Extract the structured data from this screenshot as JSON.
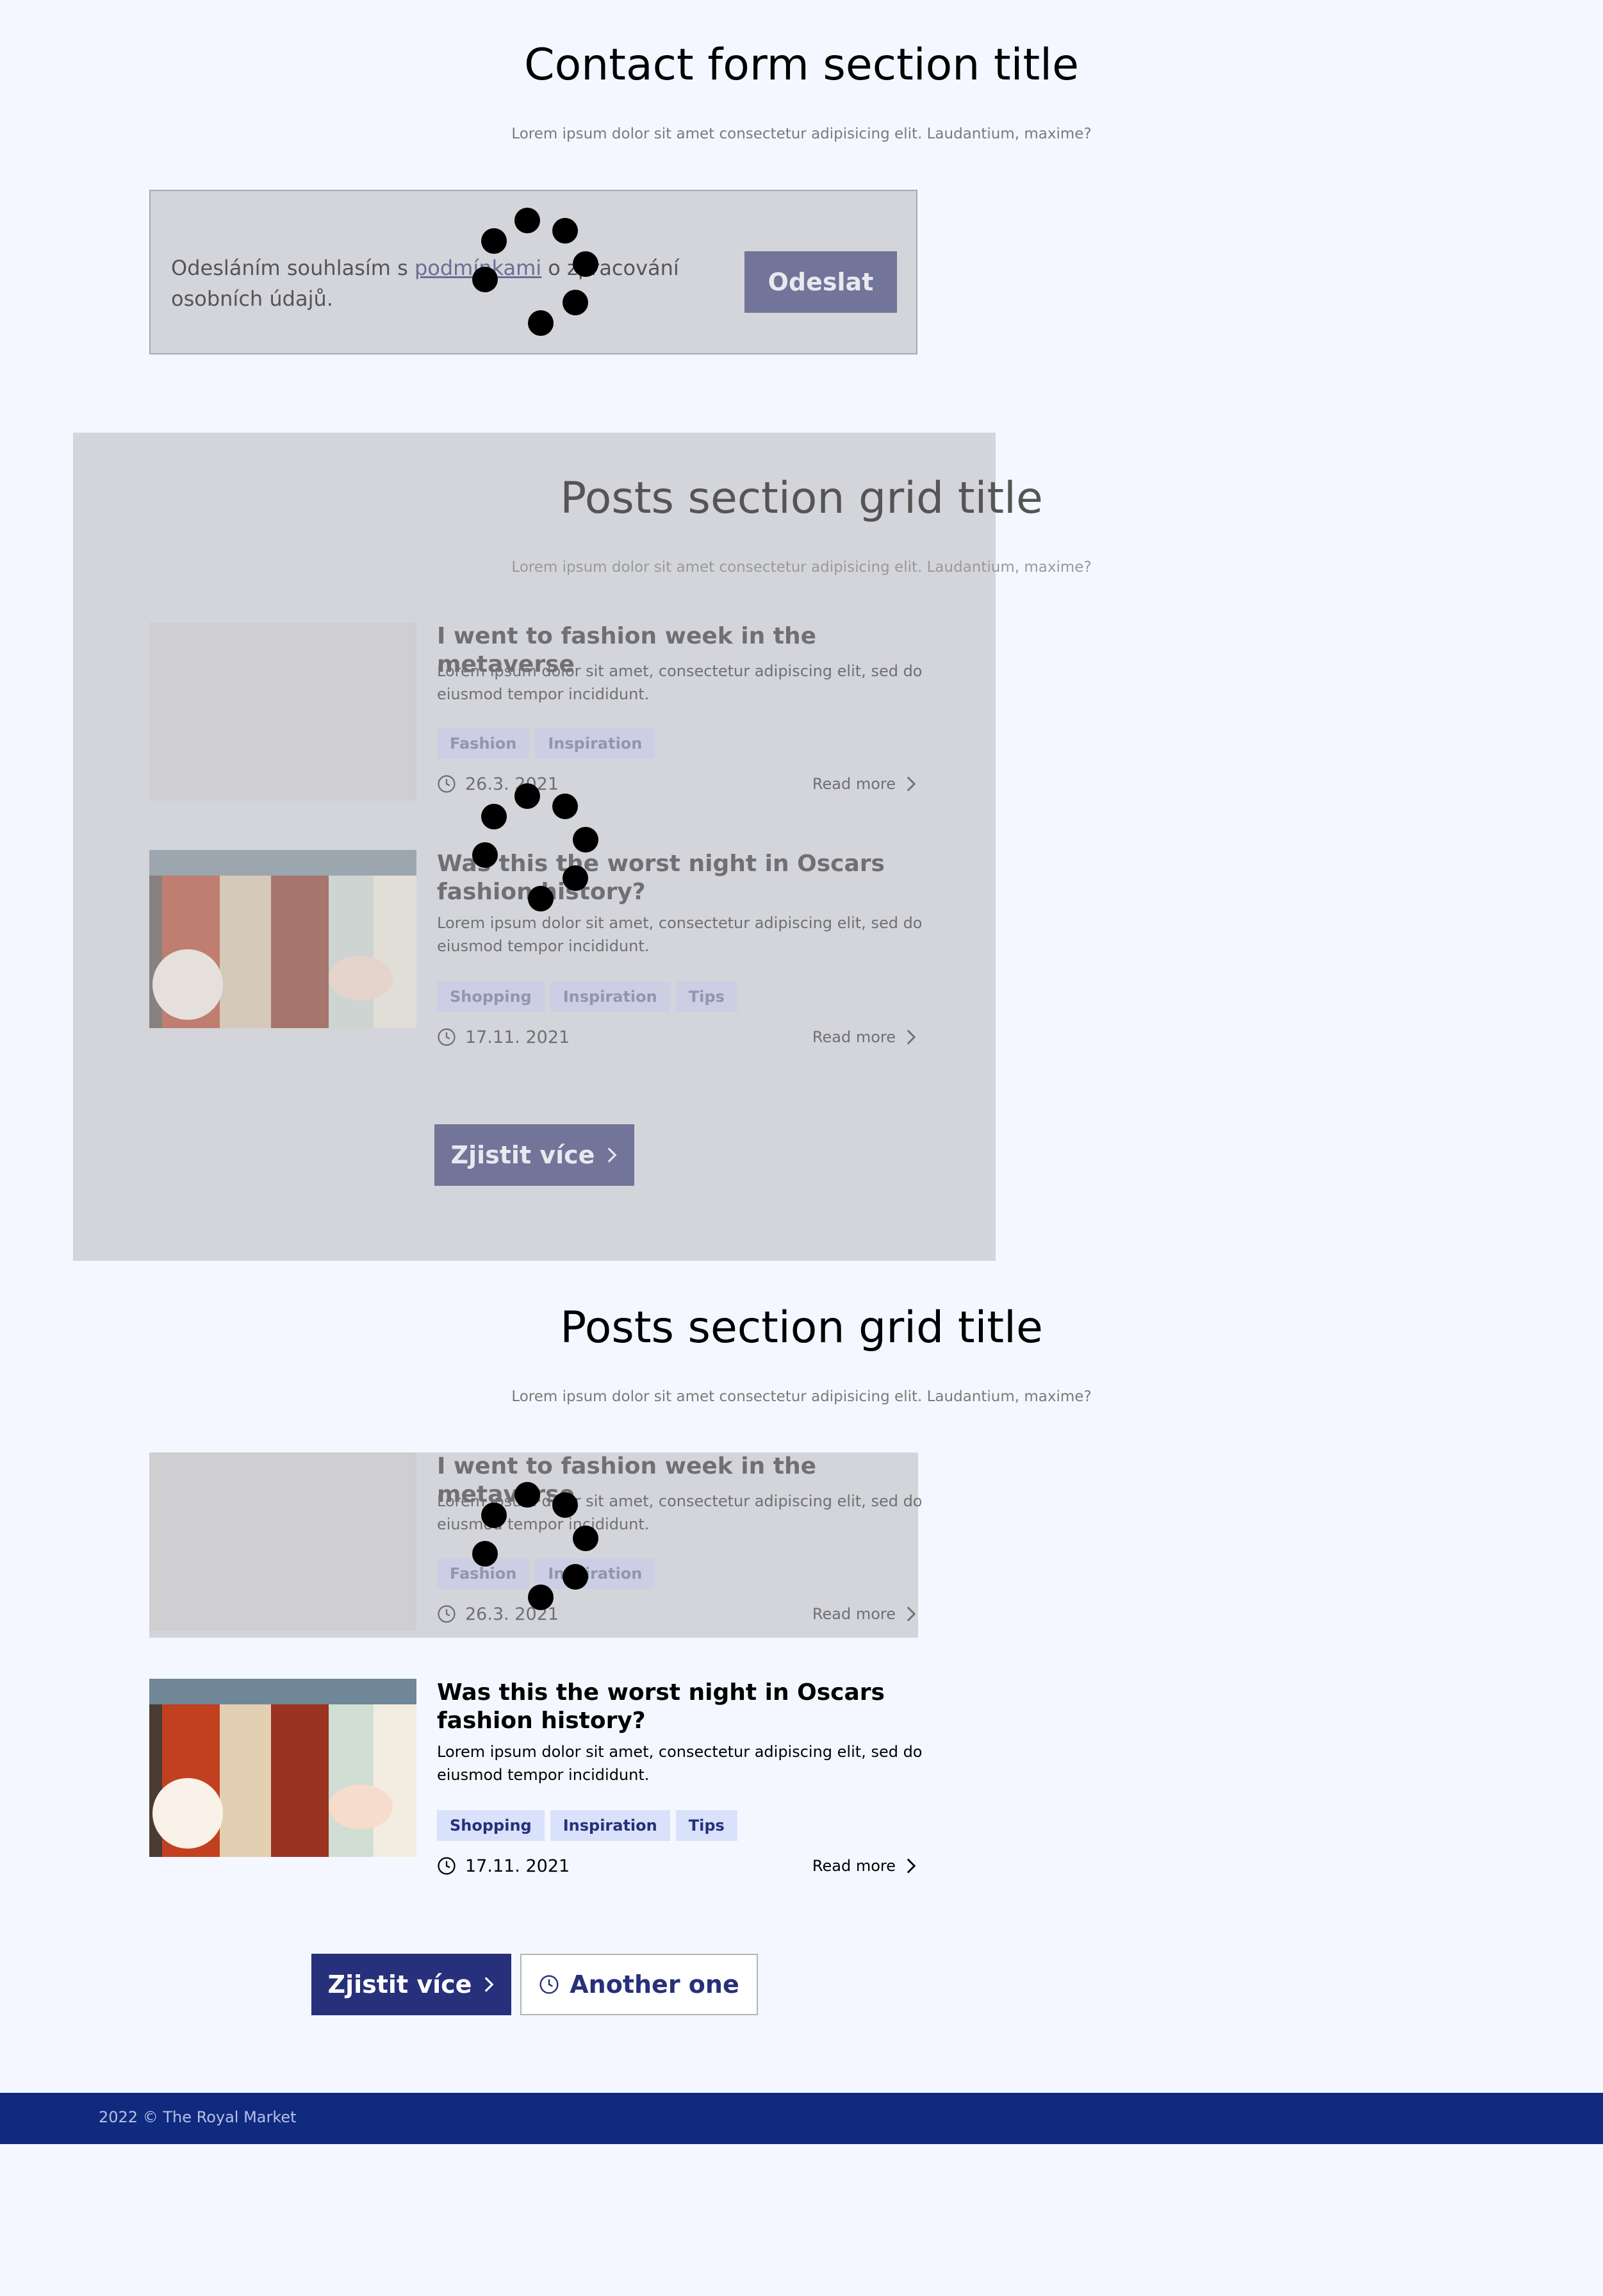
{
  "contact_section": {
    "title": "Contact form section title",
    "subtitle": "Lorem ipsum dolor sit amet consectetur adipisicing elit. Laudantium, maxime?",
    "consent_before": "Odesláním souhlasím s ",
    "consent_link": "podmínkami",
    "consent_after": " o zpracování osobních údajů.",
    "submit_label": "Odeslat"
  },
  "posts_grid_loading": {
    "title": "Posts section grid title",
    "subtitle": "Lorem ipsum dolor sit amet consectetur adipisicing elit. Laudantium, maxime?",
    "posts": [
      {
        "title": "I went to fashion week in the metaverse",
        "excerpt": "Lorem ipsum dolor sit amet, consectetur adipiscing elit, sed do eiusmod tempor incididunt.",
        "tags": [
          "Fashion",
          "Inspiration"
        ],
        "date": "26.3. 2021",
        "read_more": "Read more"
      },
      {
        "title": "Was this the worst night in Oscars fashion history?",
        "excerpt": "Lorem ipsum dolor sit amet, consectetur adipiscing elit, sed do eiusmod tempor incididunt.",
        "tags": [
          "Shopping",
          "Inspiration",
          "Tips"
        ],
        "date": "17.11. 2021",
        "read_more": "Read more"
      }
    ],
    "more_button": "Zjistit více"
  },
  "posts_grid": {
    "title": "Posts section grid title",
    "subtitle": "Lorem ipsum dolor sit amet consectetur adipisicing elit. Laudantium, maxime?",
    "posts": [
      {
        "title": "I went to fashion week in the metaverse",
        "excerpt": "Lorem ipsum dolor sit amet, consectetur adipiscing elit, sed do eiusmod tempor incididunt.",
        "tags": [
          "Fashion",
          "Inspiration"
        ],
        "date": "26.3. 2021",
        "read_more": "Read more"
      },
      {
        "title": "Was this the worst night in Oscars fashion history?",
        "excerpt": "Lorem ipsum dolor sit amet, consectetur adipiscing elit, sed do eiusmod tempor incididunt.",
        "tags": [
          "Shopping",
          "Inspiration",
          "Tips"
        ],
        "date": "17.11. 2021",
        "read_more": "Read more"
      }
    ],
    "more_button": "Zjistit více",
    "another_button": "Another one"
  },
  "footer": {
    "copyright": "2022 © The Royal Market"
  },
  "colors": {
    "primary": "#27307a",
    "footer": "#0f2a7f",
    "tag_bg": "#d9e1fb",
    "overlay": "#d4d5da",
    "background": "#f4f7ff"
  },
  "icons": [
    "clock-icon",
    "chevron-right-icon",
    "loading-spinner-icon"
  ]
}
